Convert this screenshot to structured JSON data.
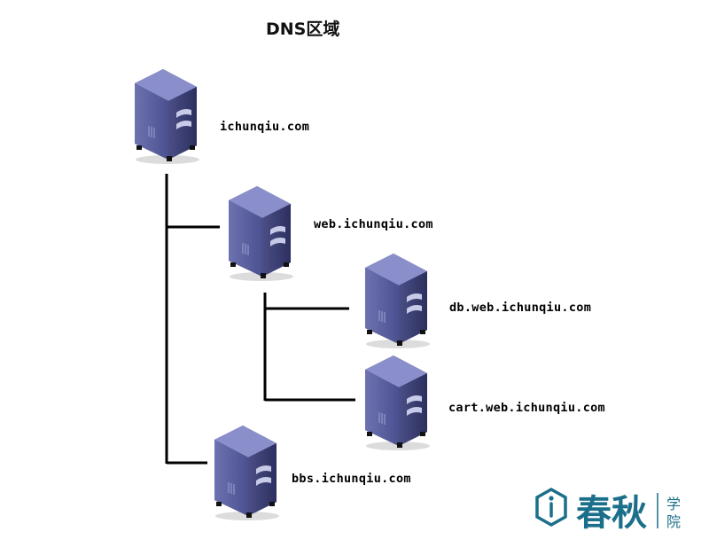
{
  "diagram": {
    "title": "DNS区域",
    "nodes": [
      {
        "id": "root",
        "label": "ichunqiu.com",
        "icon": "server-icon"
      },
      {
        "id": "web",
        "label": "web.ichunqiu.com",
        "icon": "server-icon"
      },
      {
        "id": "db",
        "label": "db.web.ichunqiu.com",
        "icon": "server-icon"
      },
      {
        "id": "cart",
        "label": "cart.web.ichunqiu.com",
        "icon": "server-icon"
      },
      {
        "id": "bbs",
        "label": "bbs.ichunqiu.com",
        "icon": "server-icon"
      }
    ],
    "edges": [
      {
        "from": "root",
        "to": "web"
      },
      {
        "from": "root",
        "to": "bbs"
      },
      {
        "from": "web",
        "to": "db"
      },
      {
        "from": "web",
        "to": "cart"
      }
    ]
  },
  "watermark": {
    "brand": "春秋",
    "sub": "学院",
    "color": "#1b6f8a"
  }
}
